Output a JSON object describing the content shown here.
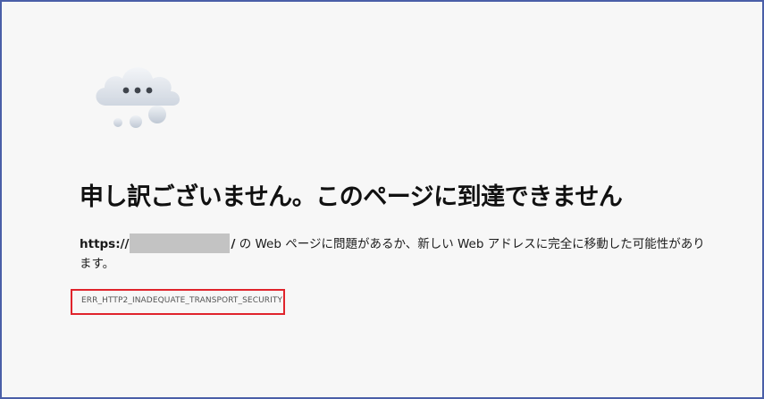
{
  "error_page": {
    "title": "申し訳ございません。このページに到達できません",
    "message": {
      "url_prefix": "https://",
      "url_suffix": "/",
      "text_line": " の Web ページに問題があるか、新しい Web アドレスに完全に移動した可能性があります。"
    },
    "error_code": "ERR_HTTP2_INADEQUATE_TRANSPORT_SECURITY",
    "icon": "cloud-dots-icon"
  },
  "colors": {
    "frame_border": "#4a5fa8",
    "highlight_box": "#e0242c",
    "background": "#f7f7f7",
    "redaction": "#c3c3c3"
  }
}
